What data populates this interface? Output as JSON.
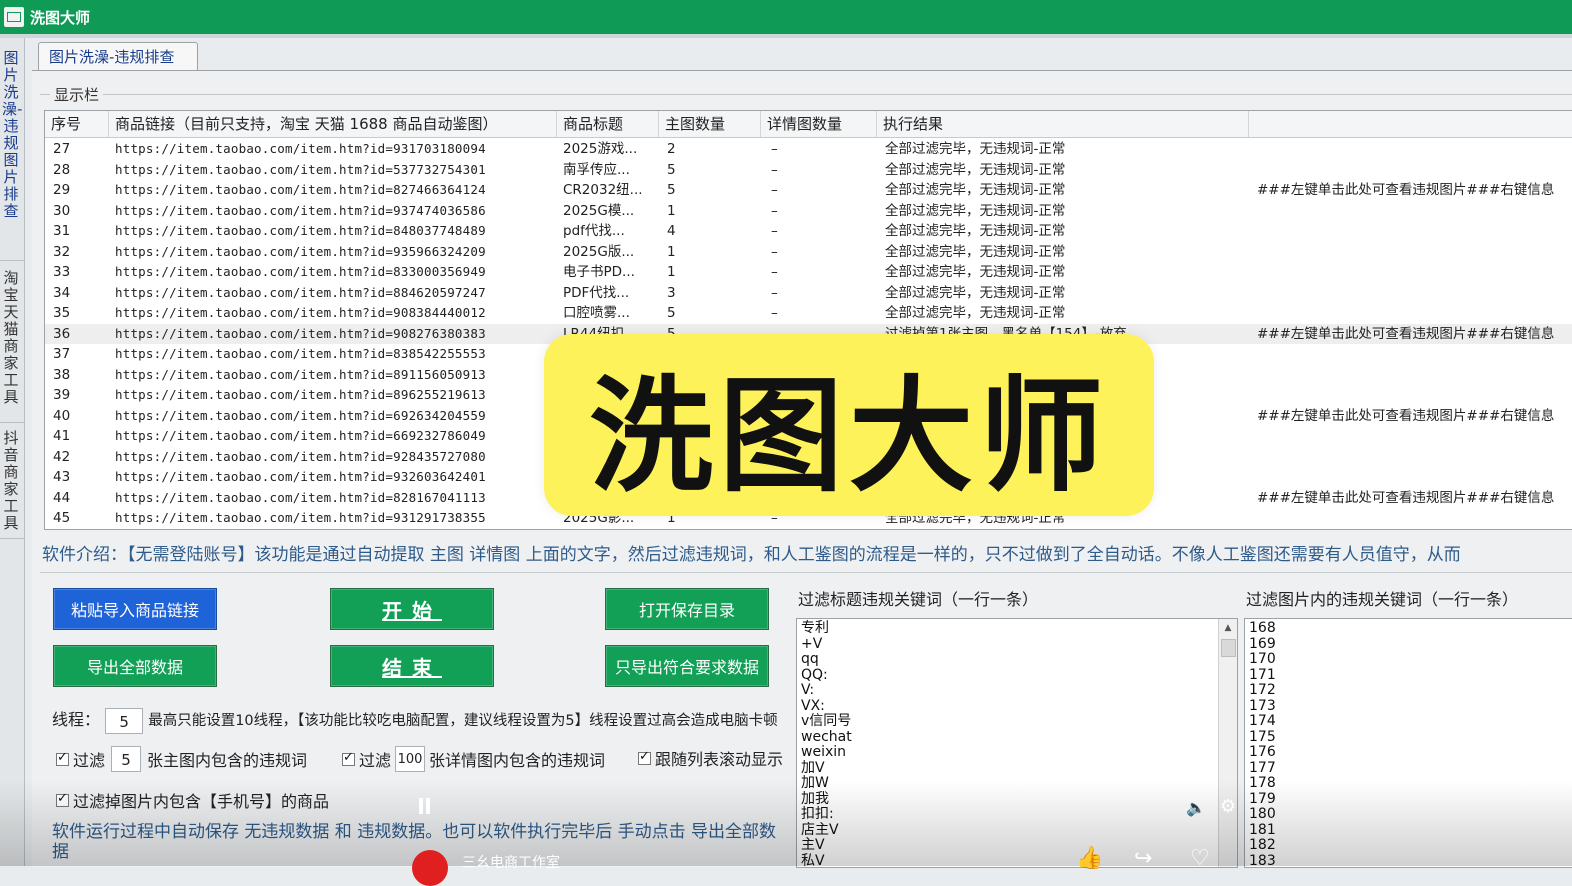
{
  "window": {
    "title": "洗图大师"
  },
  "vertical_tabs": [
    {
      "label": "图片洗澡-违规图片排查"
    },
    {
      "label": "淘宝天猫商家工具"
    },
    {
      "label": "抖音商家工具"
    }
  ],
  "tab": {
    "label": "图片洗澡-违规排查"
  },
  "display_group": {
    "label": "显示栏"
  },
  "table": {
    "headers": [
      "序号",
      "商品链接（目前只支持，淘宝 天猫 1688 商品自动鉴图）",
      "商品标题",
      "主图数量",
      "详情图数量",
      "执行结果",
      ""
    ],
    "rows": [
      {
        "idx": "27",
        "url": "https://item.taobao.com/item.htm?id=931703180094",
        "title": "2025游戏...",
        "main": "2",
        "detail": "–",
        "result": "全部过滤完毕，无违规词-正常",
        "extra": ""
      },
      {
        "idx": "28",
        "url": "https://item.taobao.com/item.htm?id=537732754301",
        "title": "南孚传应...",
        "main": "5",
        "detail": "–",
        "result": "全部过滤完毕，无违规词-正常",
        "extra": ""
      },
      {
        "idx": "29",
        "url": "https://item.taobao.com/item.htm?id=827466364124",
        "title": "CR2032纽...",
        "main": "5",
        "detail": "–",
        "result": "全部过滤完毕，无违规词-正常",
        "extra": "###左键单击此处可查看违规图片###右键信息"
      },
      {
        "idx": "30",
        "url": "https://item.taobao.com/item.htm?id=937474036586",
        "title": "2025G模...",
        "main": "1",
        "detail": "–",
        "result": "全部过滤完毕，无违规词-正常",
        "extra": ""
      },
      {
        "idx": "31",
        "url": "https://item.taobao.com/item.htm?id=848037748489",
        "title": "pdf代找...",
        "main": "4",
        "detail": "–",
        "result": "全部过滤完毕，无违规词-正常",
        "extra": ""
      },
      {
        "idx": "32",
        "url": "https://item.taobao.com/item.htm?id=935966324209",
        "title": "2025G版...",
        "main": "1",
        "detail": "–",
        "result": "全部过滤完毕，无违规词-正常",
        "extra": ""
      },
      {
        "idx": "33",
        "url": "https://item.taobao.com/item.htm?id=833000356949",
        "title": "电子书PD...",
        "main": "1",
        "detail": "–",
        "result": "全部过滤完毕，无违规词-正常",
        "extra": ""
      },
      {
        "idx": "34",
        "url": "https://item.taobao.com/item.htm?id=884620597247",
        "title": "PDF代找...",
        "main": "3",
        "detail": "–",
        "result": "全部过滤完毕，无违规词-正常",
        "extra": ""
      },
      {
        "idx": "35",
        "url": "https://item.taobao.com/item.htm?id=908384440012",
        "title": "口腔喷雾...",
        "main": "5",
        "detail": "–",
        "result": "全部过滤完毕，无违规词-正常",
        "extra": ""
      },
      {
        "idx": "36",
        "url": "https://item.taobao.com/item.htm?id=908276380383",
        "title": "LR44纽扣...",
        "main": "5",
        "detail": "–",
        "result": "过滤掉第1张主图，黑名单【154】-放弃",
        "extra": "###左键单击此处可查看违规图片###右键信息"
      },
      {
        "idx": "37",
        "url": "https://item.taobao.com/item.htm?id=838542255553",
        "title": "",
        "main": "",
        "detail": "",
        "result": "",
        "extra": ""
      },
      {
        "idx": "38",
        "url": "https://item.taobao.com/item.htm?id=891156050913",
        "title": "",
        "main": "",
        "detail": "",
        "result": "",
        "extra": ""
      },
      {
        "idx": "39",
        "url": "https://item.taobao.com/item.htm?id=896255219613",
        "title": "",
        "main": "",
        "detail": "",
        "result": "",
        "extra": ""
      },
      {
        "idx": "40",
        "url": "https://item.taobao.com/item.htm?id=692634204559",
        "title": "",
        "main": "",
        "detail": "",
        "result": "",
        "extra": "###左键单击此处可查看违规图片###右键信息"
      },
      {
        "idx": "41",
        "url": "https://item.taobao.com/item.htm?id=669232786049",
        "title": "",
        "main": "",
        "detail": "",
        "result": "",
        "extra": ""
      },
      {
        "idx": "42",
        "url": "https://item.taobao.com/item.htm?id=928435727080",
        "title": "",
        "main": "",
        "detail": "",
        "result": "",
        "extra": ""
      },
      {
        "idx": "43",
        "url": "https://item.taobao.com/item.htm?id=932603642401",
        "title": "",
        "main": "",
        "detail": "",
        "result": "",
        "extra": ""
      },
      {
        "idx": "44",
        "url": "https://item.taobao.com/item.htm?id=828167041113",
        "title": "",
        "main": "",
        "detail": "",
        "result": "",
        "extra": "###左键单击此处可查看违规图片###右键信息"
      },
      {
        "idx": "45",
        "url": "https://item.taobao.com/item.htm?id=931291738355",
        "title": "2025G影...",
        "main": "1",
        "detail": "–",
        "result": "全部过滤完毕，无违规词-正常",
        "extra": ""
      }
    ]
  },
  "watermark": {
    "text": "洗图大师"
  },
  "intro": {
    "text": "软件介绍：【无需登陆账号】该功能是通过自动提取 主图 详情图 上面的文字，然后过滤违规词，和人工鉴图的流程是一样的，只不过做到了全自动话。不像人工鉴图还需要有人员值守，从而"
  },
  "buttons": {
    "paste_import": "粘贴导入商品链接",
    "start": "开始",
    "open_dir": "打开保存目录",
    "export_all": "导出全部数据",
    "end": "结束",
    "export_match": "只导出符合要求数据"
  },
  "threads": {
    "label": "线程：",
    "value": "5",
    "note": "最高只能设置10线程，【该功能比较吃电脑配置，建议线程设置为5】线程设置过高会造成电脑卡顿"
  },
  "options": {
    "filter_main_prefix": "过滤",
    "filter_main_value": "5",
    "filter_main_suffix": "张主图内包含的违规词",
    "filter_detail_prefix": "过滤",
    "filter_detail_value": "100",
    "filter_detail_suffix": "张详情图内包含的违规词",
    "follow_scroll": "跟随列表滚动显示",
    "filter_phone": "过滤掉图片内包含【手机号】的商品"
  },
  "bottom_note": {
    "text": "软件运行过程中自动保存 无违规数据  和  违规数据。也可以软件执行完毕后 手动点击 导出全部数据"
  },
  "title_keywords": {
    "label": "过滤标题违规关键词（一行一条）",
    "items": [
      "专利",
      "+V",
      "qq",
      "QQ:",
      "V:",
      "VX:",
      "v信同号",
      "wechat",
      "weixin",
      "加V",
      "加W",
      "加我",
      "扣扣:",
      "店主V",
      "主V",
      "私V"
    ]
  },
  "image_keywords": {
    "label": "过滤图片内的违规关键词（一行一条）",
    "items": [
      "168",
      "169",
      "170",
      "171",
      "172",
      "173",
      "174",
      "175",
      "176",
      "177",
      "178",
      "179",
      "180",
      "181",
      "182",
      "183"
    ]
  },
  "video": {
    "channel": "三幺电商工作室"
  }
}
